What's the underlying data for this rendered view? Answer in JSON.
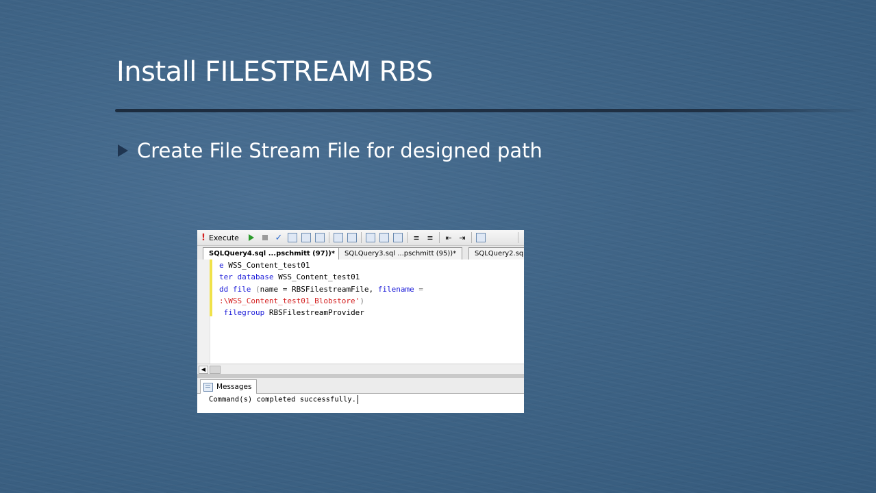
{
  "slide": {
    "title": "Install FILESTREAM RBS",
    "bullet": "Create File Stream File for designed path"
  },
  "ssms": {
    "toolbar": {
      "execute_label": "Execute"
    },
    "tabs": [
      "SQLQuery4.sql ...pschmitt (97))*",
      "SQLQuery3.sql ...pschmitt (95))*",
      "SQLQuery2.sq"
    ],
    "code": {
      "line1_kw": "e",
      "line1_rest": " WSS_Content_test01",
      "line2_kw": "ter database",
      "line2_rest": " WSS_Content_test01",
      "line3_kw": "dd file",
      "line3_paren": " (",
      "line3_mid": "name = RBSFilestreamFile, ",
      "line3_kw2": "filename",
      "line3_eq": " =",
      "line4_str": ":\\WSS_Content_test01_Blobstore'",
      "line4_close": ")",
      "line5_kw": " filegroup",
      "line5_rest": " RBSFilestreamProvider"
    },
    "messages_tab": "Messages",
    "message": "Command(s) completed successfully."
  }
}
